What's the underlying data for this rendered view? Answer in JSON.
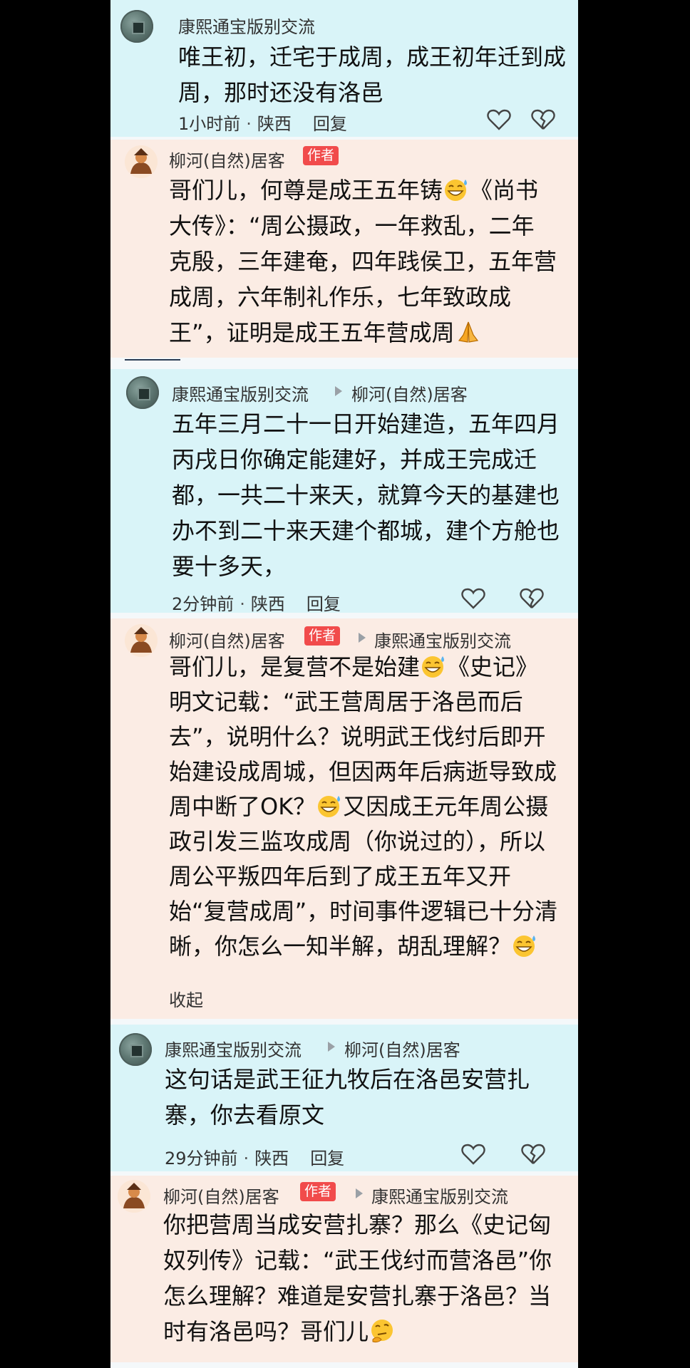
{
  "comments": [
    {
      "username": "康熙通宝版别交流",
      "line1": "唯王初，迁宅于成周，成王初年迁到成",
      "line2": "周，那时还没有洛邑",
      "time": "1小时前",
      "location": "陕西",
      "reply": "回复"
    },
    {
      "username": "柳河(自然)居客",
      "badge": "作者",
      "lines": [
        "哥们儿，何尊是成王五年铸",
        "《尚书",
        "大传》：“周公摄政，一年救乱，二年",
        "克殷，三年建奄，四年践侯卫，五年营",
        "成周，六年制礼作乐，七年致政成",
        "王”，证明是成王五年营成周"
      ]
    },
    {
      "username": "康熙通宝版别交流",
      "reply_to": "柳河(自然)居客",
      "lines": [
        "五年三月二十一日开始建造，五年四月",
        "丙戌日你确定能建好，并成王完成迁",
        "都，一共二十来天，就算今天的基建也",
        "办不到二十来天建个都城，建个方舱也",
        "要十多天，"
      ],
      "time": "2分钟前",
      "location": "陕西",
      "reply": "回复"
    },
    {
      "username": "柳河(自然)居客",
      "badge": "作者",
      "reply_to": "康熙通宝版别交流",
      "lines": [
        "哥们儿，是复营不是始建",
        "《史记》",
        "明文记载：“武王营周居于洛邑而后",
        "去”，说明什么？说明武王伐纣后即开",
        "始建设成周城，但因两年后病逝导致成",
        "周中断了OK？",
        "又因成王元年周公摄",
        "政引发三监攻成周（你说过的），所以",
        "周公平叛四年后到了成王五年又开",
        "始“复营成周”，时间事件逻辑已十分清",
        "晰，你怎么一知半解，胡乱理解？"
      ],
      "collapse": "收起"
    },
    {
      "username": "康熙通宝版别交流",
      "reply_to": "柳河(自然)居客",
      "lines": [
        "这句话是武王征九牧后在洛邑安营扎",
        "寨，你去看原文"
      ],
      "time": "29分钟前",
      "location": "陕西",
      "reply": "回复"
    },
    {
      "username": "柳河(自然)居客",
      "badge": "作者",
      "reply_to": "康熙通宝版别交流",
      "lines": [
        "你把营周当成安营扎寨？那么《史记匈",
        "奴列传》记载：“武王伐纣而营洛邑”你",
        "怎么理解？难道是安营扎寨于洛邑？当",
        "时有洛邑吗？哥们儿"
      ]
    }
  ],
  "colors": {
    "cyan_card": "#d9f4f8",
    "peach_card": "#fbece4",
    "author_badge": "#f14b4b"
  },
  "icons": [
    "coin-avatar",
    "person-avatar",
    "heart-icon",
    "heartbreak-icon",
    "reply-arrow-icon",
    "grin-sweat-emoji",
    "folded-hands-emoji",
    "thinking-emoji"
  ]
}
